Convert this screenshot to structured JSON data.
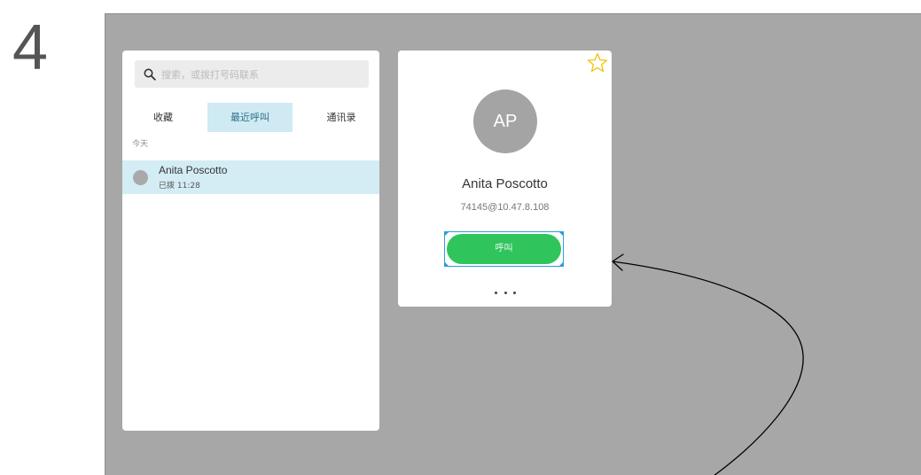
{
  "step": {
    "number": "4"
  },
  "search": {
    "placeholder": "搜索，或拨打号码联系"
  },
  "tabs": [
    {
      "label": "收藏"
    },
    {
      "label": "最近呼叫",
      "selected": true
    },
    {
      "label": "通讯录"
    }
  ],
  "recent": {
    "section_label": "今天",
    "items": [
      {
        "name": "Anita Poscotto",
        "status": "已拨 11:28"
      }
    ]
  },
  "contact": {
    "initials": "AP",
    "name": "Anita Poscotto",
    "address": "74145@10.47.8.108",
    "call_label": "呼叫"
  },
  "icons": {
    "search": "search-icon",
    "favorite": "star-outline-icon",
    "more": "more-dots-icon"
  },
  "colors": {
    "screen_bg": "#a7a7a7",
    "call_green": "#2fc55c",
    "highlight_blue": "#d4edf5",
    "focus_blue": "#2b9ed6",
    "star_yellow": "#f2c200"
  }
}
